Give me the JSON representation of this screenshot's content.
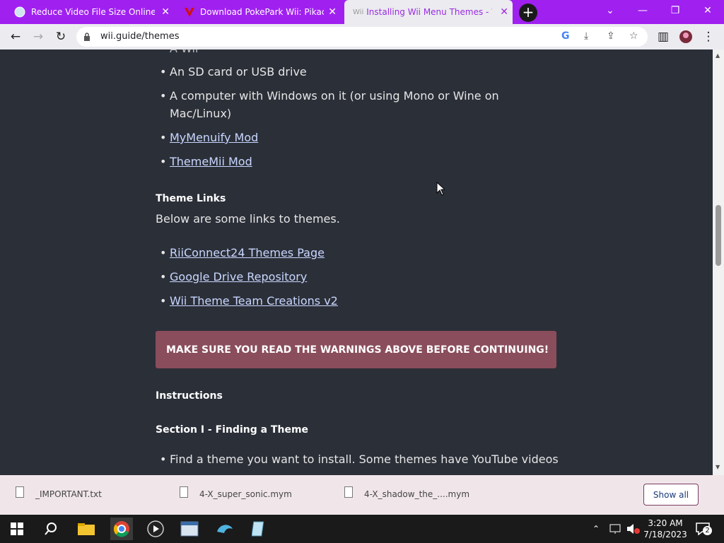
{
  "tabs": [
    {
      "title": "Reduce Video File Size Online, M"
    },
    {
      "title": "Download PokePark Wii: Pikachu"
    },
    {
      "title": "Installing Wii Menu Themes - Wi"
    }
  ],
  "toolbar": {
    "url": "wii.guide/themes"
  },
  "content": {
    "partial_top": "A Wii",
    "req_items": [
      {
        "text": "An SD card or USB drive"
      },
      {
        "text": "A computer with Windows on it (or using Mono or Wine on"
      },
      {
        "text": "Mac/Linux)"
      },
      {
        "text": "MyMenuify Mod"
      },
      {
        "text": "ThemeMii Mod"
      }
    ],
    "theme_links_heading": "Theme Links",
    "theme_links_intro": "Below are some links to themes.",
    "theme_links": [
      {
        "text": "RiiConnect24 Themes Page"
      },
      {
        "text": "Google Drive Repository"
      },
      {
        "text": "Wii Theme Team Creations v2"
      }
    ],
    "warning": "MAKE SURE YOU READ THE WARNINGS ABOVE BEFORE CONTINUING!",
    "instructions_heading": "Instructions",
    "section_heading": "Section I - Finding a Theme",
    "find_item": "Find a theme you want to install. Some themes have YouTube videos"
  },
  "downloads": [
    {
      "name": "_IMPORTANT.txt"
    },
    {
      "name": "4-X_super_sonic.mym"
    },
    {
      "name": "4-X_shadow_the_....mym"
    }
  ],
  "show_all": "Show all",
  "clock": {
    "time": "3:20 AM",
    "date": "7/18/2023"
  },
  "notifications": "2"
}
